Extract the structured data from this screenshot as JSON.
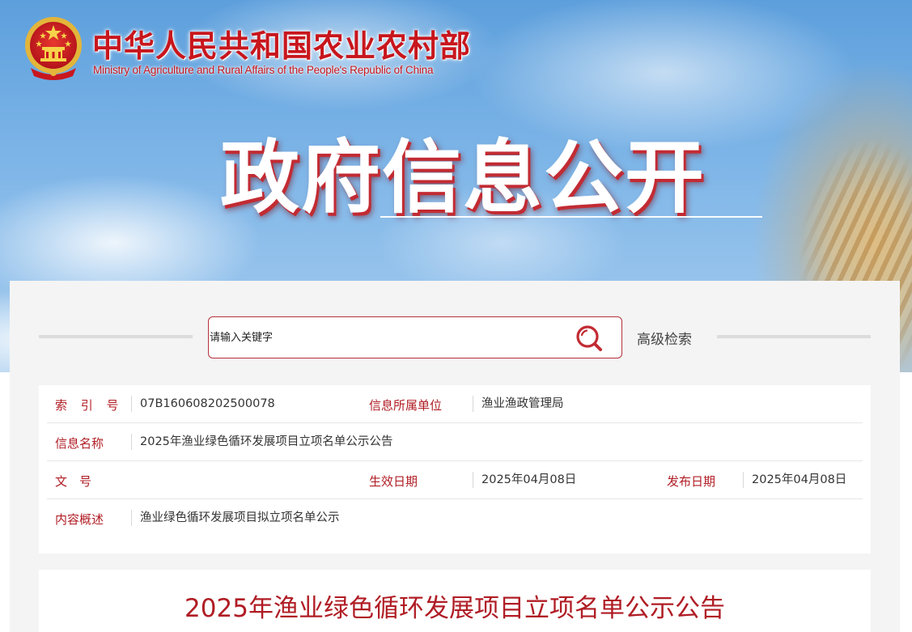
{
  "header": {
    "site_title": "中华人民共和国农业农村部",
    "site_subtitle": "Ministry of Agriculture and Rural Affairs of the People's Republic of China",
    "banner_title": "政府信息公开"
  },
  "search": {
    "placeholder": "请输入关键字",
    "advanced_label": "高级检索"
  },
  "info": {
    "index_label": "索 引 号",
    "index_value": "07B160608202500078",
    "unit_label": "信息所属单位",
    "unit_value": "渔业渔政管理局",
    "name_label": "信息名称",
    "name_value": "2025年渔业绿色循环发展项目立项名单公示公告",
    "docno_label": "文　号",
    "docno_value": "",
    "effective_label": "生效日期",
    "effective_value": "2025年04月08日",
    "publish_label": "发布日期",
    "publish_value": "2025年04月08日",
    "summary_label": "内容概述",
    "summary_value": "渔业绿色循环发展项目拟立项名单公示"
  },
  "article": {
    "title": "2025年渔业绿色循环发展项目立项名单公示公告"
  },
  "colors": {
    "brand_red": "#c8161d",
    "label_red": "#b01d25",
    "search_border": "#b5303a"
  }
}
